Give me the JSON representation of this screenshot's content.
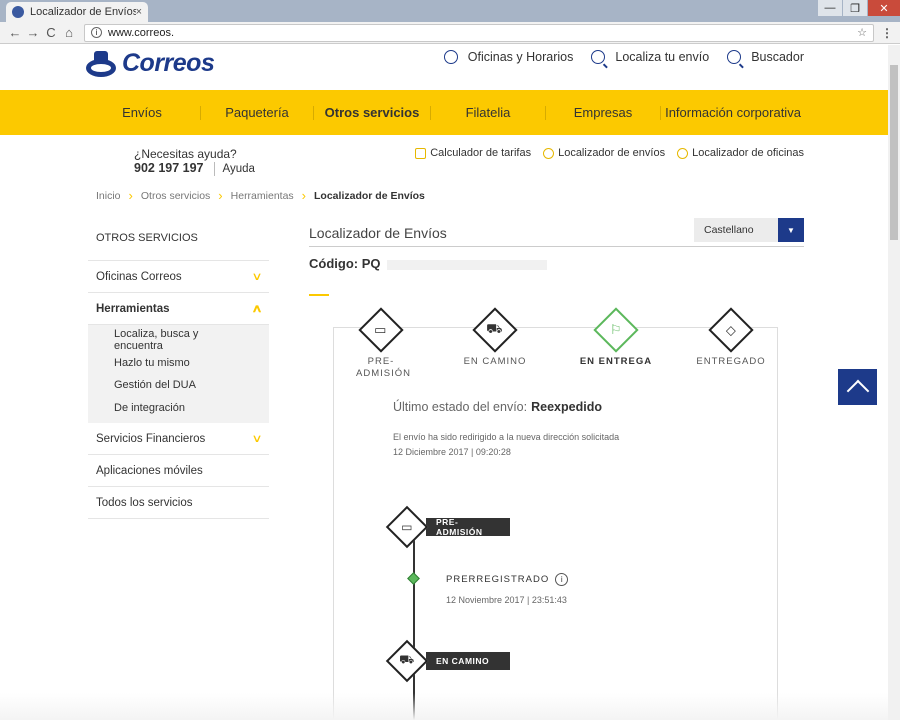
{
  "browser": {
    "tab_title": "Localizador de Envíos",
    "tab_close": "×",
    "url": "www.correos.",
    "back": "←",
    "forward": "→",
    "reload": "C",
    "home": "⌂",
    "star": "☆",
    "menu": "⋮",
    "win_min": "—",
    "win_max": "❐",
    "win_close": "✕"
  },
  "header": {
    "brand": "Correos",
    "links": [
      {
        "label": "Oficinas y Horarios",
        "icon": "clock-icon"
      },
      {
        "label": "Localiza tu envío",
        "icon": "search-icon"
      },
      {
        "label": "Buscador",
        "icon": "search-icon"
      }
    ]
  },
  "nav": {
    "items": [
      "Envíos",
      "Paquetería",
      "Otros servicios",
      "Filatelia",
      "Empresas",
      "Información corporativa"
    ],
    "active": "Otros servicios"
  },
  "help": {
    "question": "¿Necesitas ayuda?",
    "phone": "902 197 197",
    "link": "Ayuda"
  },
  "tools": [
    "Calculador de tarifas",
    "Localizador de envíos",
    "Localizador de oficinas"
  ],
  "breadcrumb": [
    "Inicio",
    "Otros servicios",
    "Herramientas",
    "Localizador de Envíos"
  ],
  "sidebar": {
    "title": "OTROS SERVICIOS",
    "items": [
      {
        "label": "Oficinas Correos",
        "chevron": "∨"
      },
      {
        "label": "Herramientas",
        "chevron": "∧"
      },
      {
        "label": "Servicios Financieros",
        "chevron": "∨"
      },
      {
        "label": "Aplicaciones móviles"
      },
      {
        "label": "Todos los servicios"
      }
    ],
    "subitems": [
      "Localiza, busca y encuentra",
      "Hazlo tu mismo",
      "Gestión del DUA",
      "De integración"
    ]
  },
  "main": {
    "title": "Localizador de Envíos",
    "language": "Castellano",
    "code_label": "Código: PQ",
    "stages": [
      {
        "label": "PRE-ADMISIÓN",
        "icon": "monitor-icon",
        "glyph": "▭"
      },
      {
        "label": "EN CAMINO",
        "icon": "truck-icon",
        "glyph": "⛟"
      },
      {
        "label": "EN ENTREGA",
        "icon": "hand-truck-icon",
        "glyph": "⚐"
      },
      {
        "label": "ENTREGADO",
        "icon": "box-icon",
        "glyph": "◇"
      }
    ],
    "current_stage": "EN ENTREGA",
    "last_status_label": "Último estado del envío:",
    "last_status_value": "Reexpedido",
    "status_description": "El envío ha sido redirigido a la nueva dirección solicitada",
    "status_date": "12 Diciembre 2017 | 09:20:28",
    "timeline": {
      "step1": "PRE-ADMISIÓN",
      "event_name": "PRERREGISTRADO",
      "event_info": "i",
      "event_date": "12 Noviembre 2017 | 23:51:43",
      "step2": "EN CAMINO"
    }
  }
}
